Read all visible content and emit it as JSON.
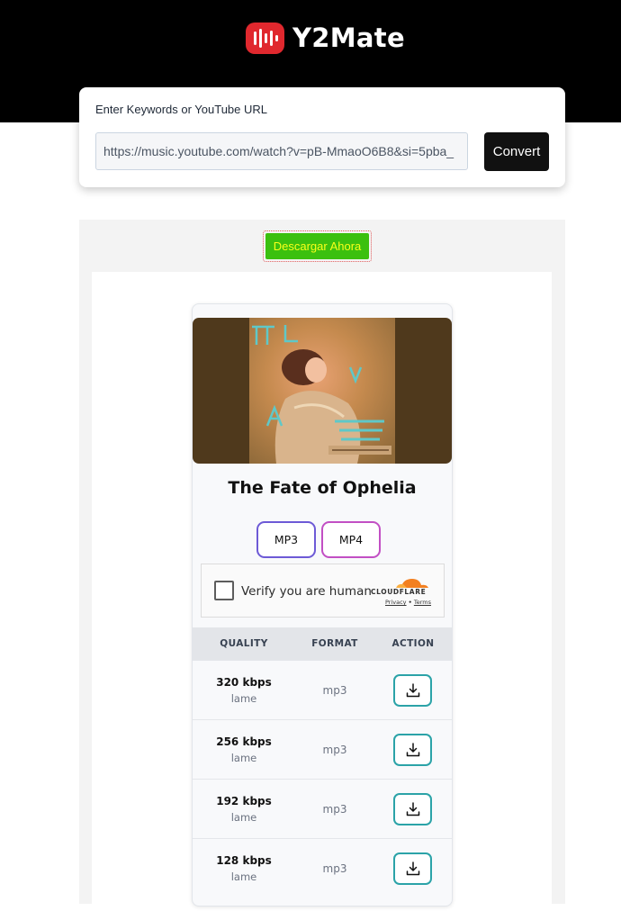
{
  "brand": {
    "name": "Y2Mate",
    "logo_color": "#e0282e"
  },
  "search": {
    "label": "Enter Keywords or YouTube URL",
    "value": "https://music.youtube.com/watch?v=pB-MmaoO6B8&si=5pba_",
    "convert_label": "Convert"
  },
  "ad": {
    "download_label": "Descargar Ahora",
    "button_color": "#3bc00f"
  },
  "result": {
    "title": "The Fate of Ophelia",
    "thumbnail_icon": "album-cover-image",
    "format_tabs": [
      "MP3",
      "MP4"
    ],
    "captcha": {
      "label": "Verify you are human",
      "provider": "CLOUDFLARE",
      "privacy": "Privacy",
      "separator": "•",
      "terms": "Terms"
    },
    "table": {
      "headers": [
        "QUALITY",
        "FORMAT",
        "ACTION"
      ],
      "rows": [
        {
          "quality": "320 kbps",
          "encoder": "lame",
          "format": "mp3",
          "action_icon": "download-icon"
        },
        {
          "quality": "256 kbps",
          "encoder": "lame",
          "format": "mp3",
          "action_icon": "download-icon"
        },
        {
          "quality": "192 kbps",
          "encoder": "lame",
          "format": "mp3",
          "action_icon": "download-icon"
        },
        {
          "quality": "128 kbps",
          "encoder": "lame",
          "format": "mp3",
          "action_icon": "download-icon"
        }
      ]
    }
  }
}
